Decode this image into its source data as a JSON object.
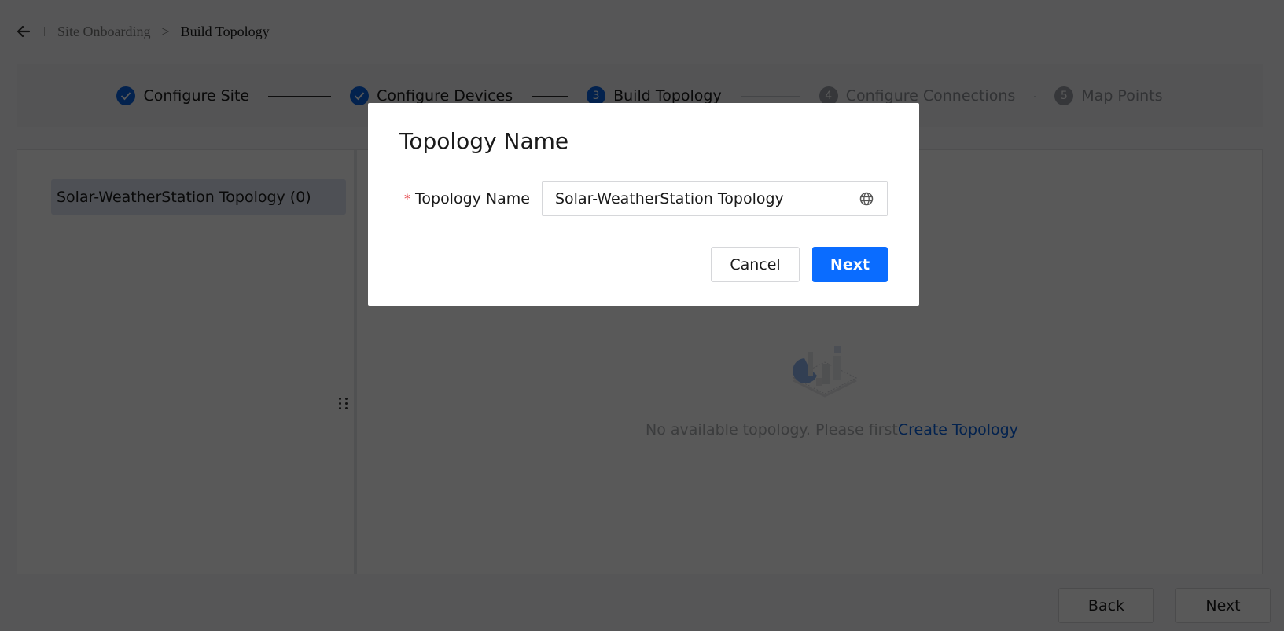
{
  "breadcrumb": {
    "back_icon": "arrow-left-icon",
    "parent": "Site Onboarding",
    "separator": ">",
    "current": "Build Topology"
  },
  "steps": [
    {
      "index": "1",
      "label": "Configure Site",
      "status": "done",
      "icon": "check-icon"
    },
    {
      "index": "2",
      "label": "Configure Devices",
      "status": "done",
      "icon": "check-icon"
    },
    {
      "index": "3",
      "label": "Build Topology",
      "status": "active"
    },
    {
      "index": "4",
      "label": "Configure Connections",
      "status": "todo"
    },
    {
      "index": "5",
      "label": "Map Points",
      "status": "todo"
    }
  ],
  "left_pane": {
    "items": [
      {
        "label": "Solar-WeatherStation Topology (0)",
        "selected": true
      }
    ]
  },
  "empty_state": {
    "illustration": "empty-chart-illustration",
    "text": "No available topology. Please first",
    "link": "Create Topology"
  },
  "footer": {
    "back_label": "Back",
    "next_label": "Next"
  },
  "modal": {
    "title": "Topology Name",
    "field_label": "Topology Name",
    "required_mark": "*",
    "field_value": "Solar-WeatherStation Topology",
    "field_icon": "globe-icon",
    "cancel_label": "Cancel",
    "next_label": "Next"
  },
  "colors": {
    "primary": "#0a6cff",
    "required": "#e5484d",
    "selected_item_bg": "#dfe6f4"
  }
}
